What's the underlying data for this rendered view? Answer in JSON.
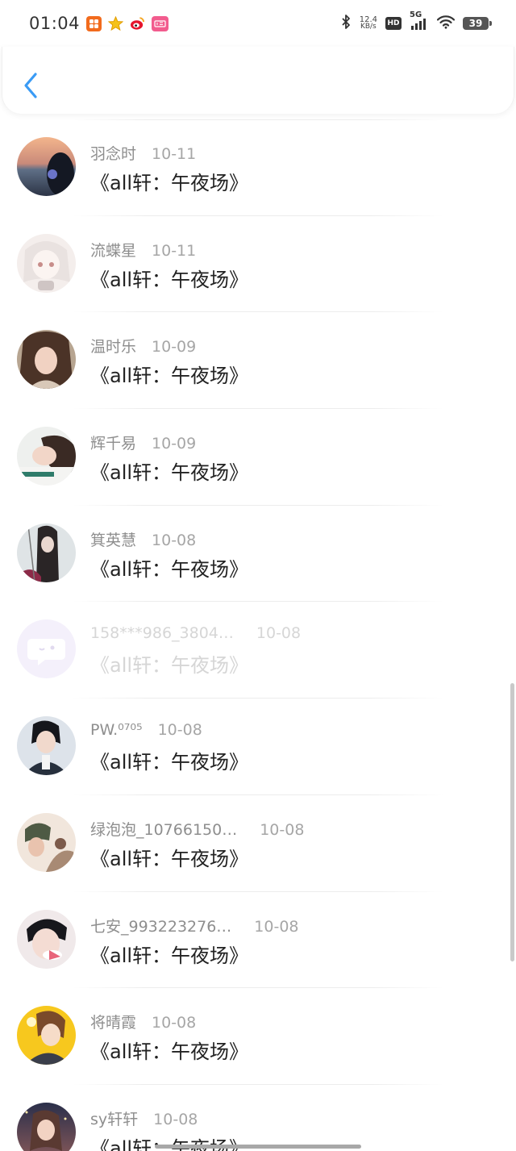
{
  "status_bar": {
    "time": "01:04",
    "net_speed_value": "12.4",
    "net_speed_unit": "KB/s",
    "hd": "HD",
    "network": "5G",
    "battery": "39"
  },
  "colors": {
    "accent": "#3a9bf5",
    "name": "#8e8e8e",
    "date": "#a6a6a6",
    "title": "#222222"
  },
  "list": {
    "items": [
      {
        "name": "羽念时",
        "date": "10-11",
        "title": "《all轩：午夜场》"
      },
      {
        "name": "流蝶星",
        "date": "10-11",
        "title": "《all轩：午夜场》"
      },
      {
        "name": "温时乐",
        "date": "10-09",
        "title": "《all轩：午夜场》"
      },
      {
        "name": "辉千易",
        "date": "10-09",
        "title": "《all轩：午夜场》"
      },
      {
        "name": "箕英慧",
        "date": "10-08",
        "title": "《all轩：午夜场》"
      },
      {
        "name": "158***986_3804…",
        "date": "10-08",
        "title": "《all轩：午夜场》"
      },
      {
        "name": "PW.⁰⁷⁰⁵",
        "date": "10-08",
        "title": "《all轩：午夜场》"
      },
      {
        "name": "绿泡泡_10766150…",
        "date": "10-08",
        "title": "《all轩：午夜场》"
      },
      {
        "name": "七安_993223276…",
        "date": "10-08",
        "title": "《all轩：午夜场》"
      },
      {
        "name": "将晴霞",
        "date": "10-08",
        "title": "《all轩：午夜场》"
      },
      {
        "name": "sy轩轩",
        "date": "10-08",
        "title": "《all轩：午夜场》"
      }
    ]
  }
}
